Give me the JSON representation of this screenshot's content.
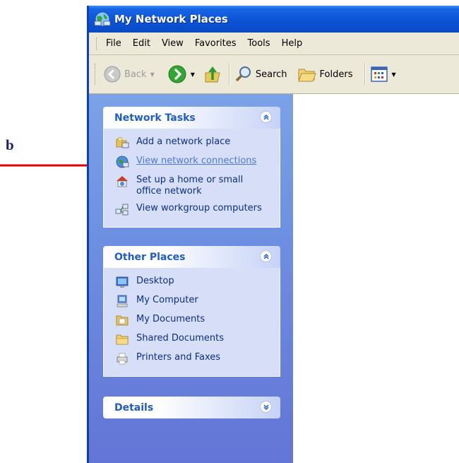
{
  "annotation": {
    "letter": "b"
  },
  "window": {
    "title": "My Network Places"
  },
  "menu": {
    "items": [
      "File",
      "Edit",
      "View",
      "Favorites",
      "Tools",
      "Help"
    ]
  },
  "toolbar": {
    "back_label": "Back",
    "search_label": "Search",
    "folders_label": "Folders"
  },
  "network_tasks": {
    "title": "Network Tasks",
    "items": [
      {
        "label": "Add a network place",
        "icon": "add-network-place-icon"
      },
      {
        "label": "View network connections",
        "icon": "network-connections-icon"
      },
      {
        "label": "Set up a home or small office network",
        "icon": "home-network-icon"
      },
      {
        "label": "View workgroup computers",
        "icon": "workgroup-computers-icon"
      }
    ]
  },
  "other_places": {
    "title": "Other Places",
    "items": [
      {
        "label": "Desktop",
        "icon": "desktop-icon"
      },
      {
        "label": "My Computer",
        "icon": "my-computer-icon"
      },
      {
        "label": "My Documents",
        "icon": "my-documents-icon"
      },
      {
        "label": "Shared Documents",
        "icon": "shared-documents-icon"
      },
      {
        "label": "Printers and Faxes",
        "icon": "printers-faxes-icon"
      }
    ]
  },
  "details": {
    "title": "Details"
  },
  "colors": {
    "titlebar": "#0b54d6",
    "taskpane": "#6d8fe1",
    "panel_title": "#215dc6",
    "link": "#0c2e8a",
    "link_hover": "#4f79d8",
    "arrow": "#e00000"
  }
}
